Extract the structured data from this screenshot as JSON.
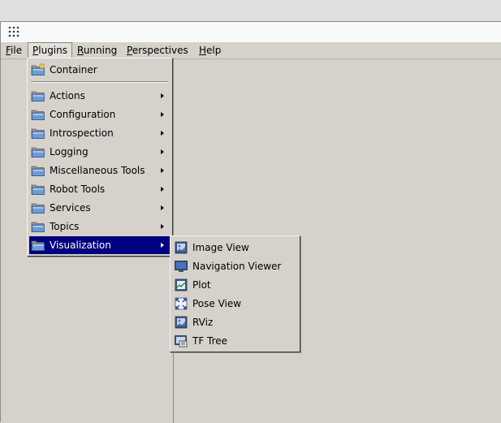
{
  "menubar": {
    "items": [
      {
        "label": "File",
        "ul": "F",
        "rest": "ile"
      },
      {
        "label": "Plugins",
        "ul": "P",
        "rest": "lugins"
      },
      {
        "label": "Running",
        "ul": "R",
        "rest": "unning"
      },
      {
        "label": "Perspectives",
        "ul": "P",
        "rest": "erspectives"
      },
      {
        "label": "Help",
        "ul": "H",
        "rest": "elp"
      }
    ],
    "open_menu": "Plugins"
  },
  "plugins_menu": {
    "top_item": "Container",
    "items": [
      "Actions",
      "Configuration",
      "Introspection",
      "Logging",
      "Miscellaneous Tools",
      "Robot Tools",
      "Services",
      "Topics",
      "Visualization"
    ],
    "highlighted": "Visualization"
  },
  "visualization_menu": {
    "items": [
      {
        "label": "Image View",
        "icon": "image-view-icon"
      },
      {
        "label": "Navigation Viewer",
        "icon": "monitor-icon"
      },
      {
        "label": "Plot",
        "icon": "plot-icon"
      },
      {
        "label": "Pose View",
        "icon": "fullscreen-icon"
      },
      {
        "label": "RViz",
        "icon": "rviz-icon"
      },
      {
        "label": "TF Tree",
        "icon": "tf-tree-icon"
      }
    ]
  },
  "colors": {
    "highlight": "#000080",
    "background": "#d6d2cb",
    "folder_blue": "#6e9bd4"
  }
}
